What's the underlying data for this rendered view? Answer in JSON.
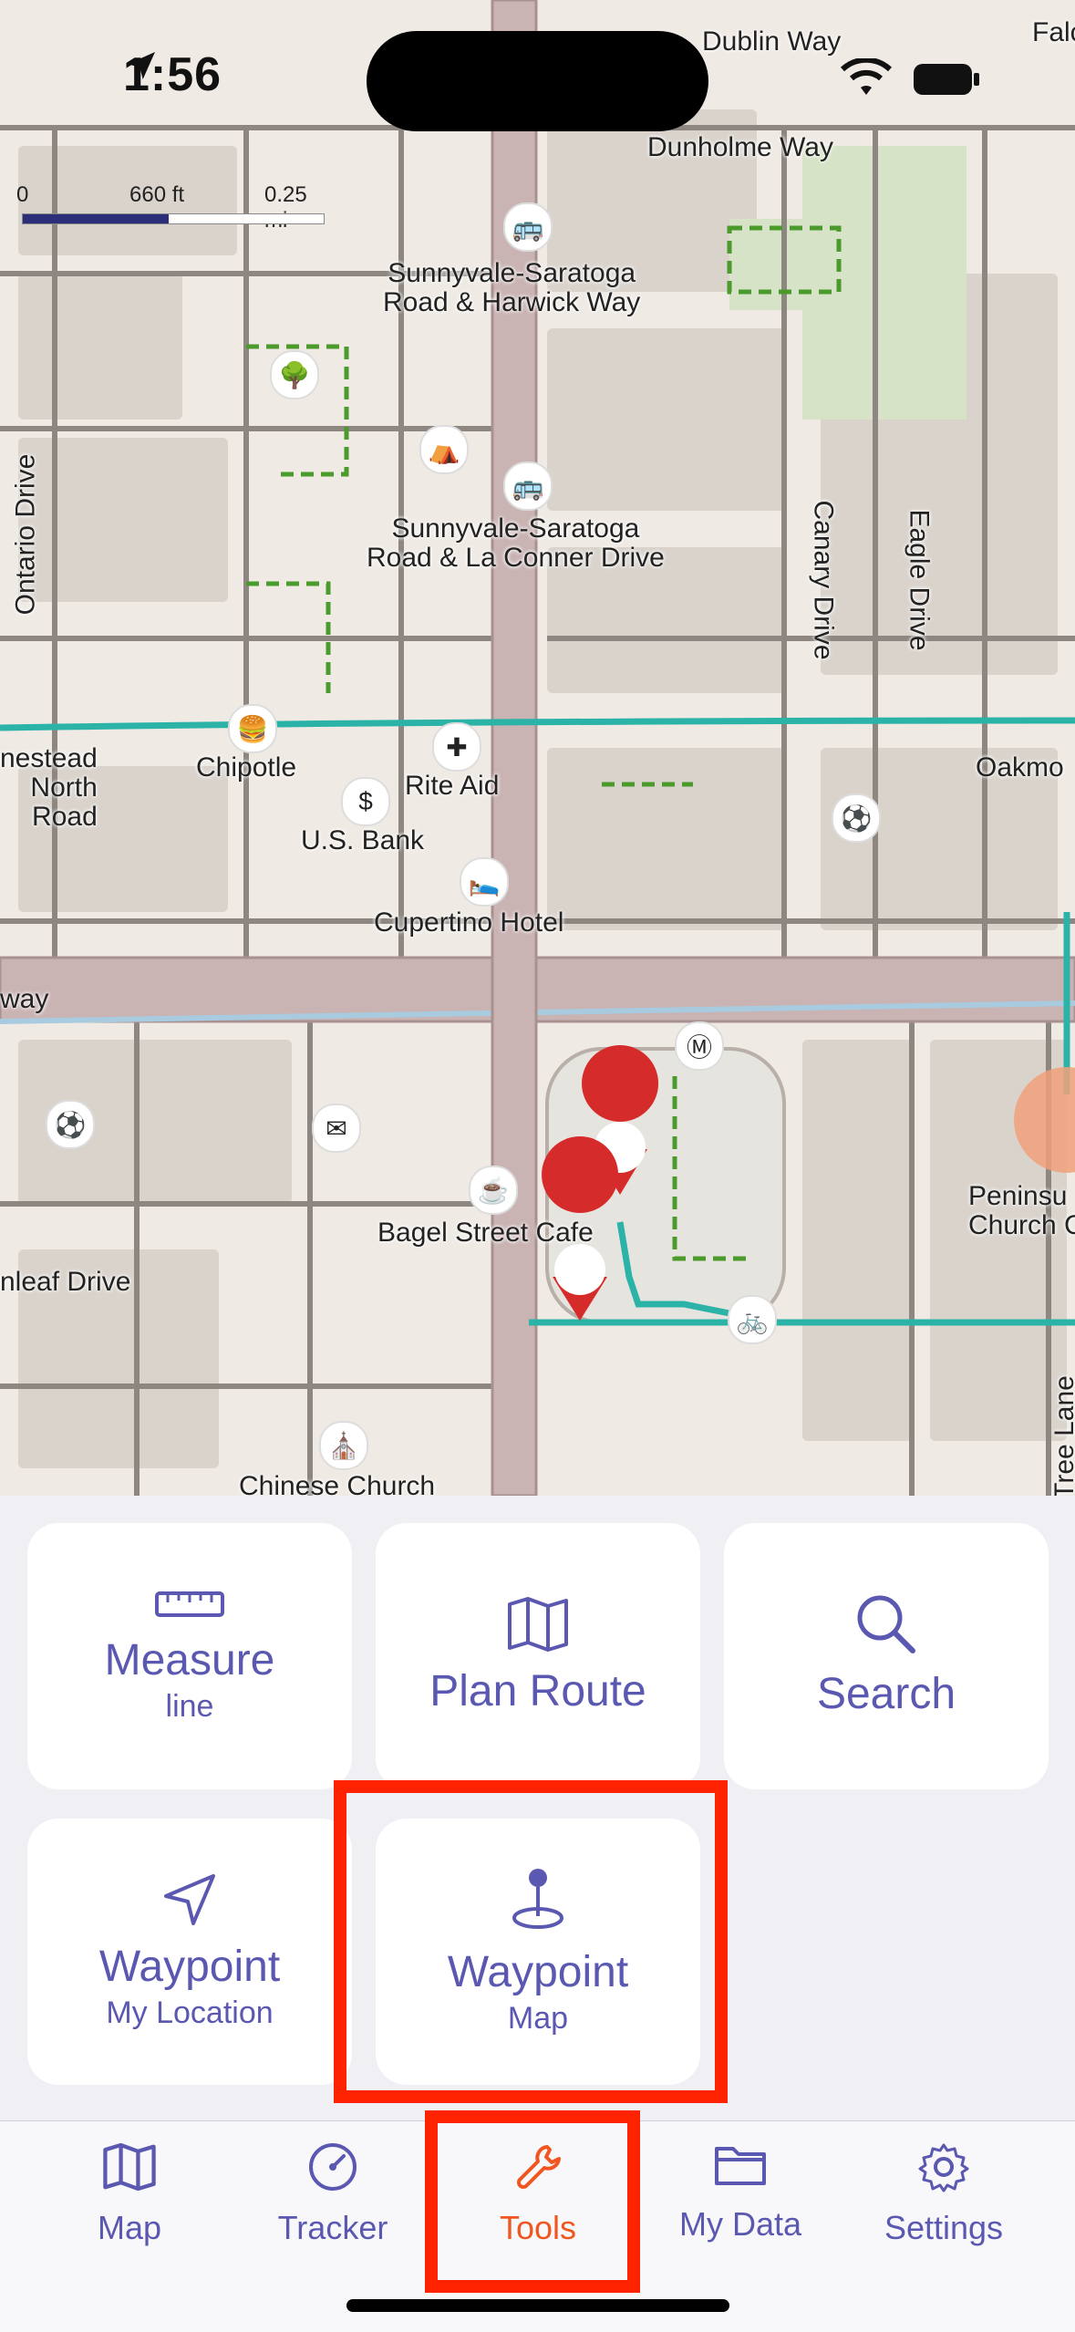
{
  "status_bar": {
    "time": "1:56"
  },
  "map": {
    "scale": {
      "zero": "0",
      "mid": "660 ft",
      "end": "0.25 mi"
    },
    "labels": {
      "dublin_way": "Dublin Way",
      "dunholme_way": "Dunholme Way",
      "falcon": "Falc",
      "stop1_line1": "Sunnyvale-Saratoga",
      "stop1_line2": "Road & Harwick Way",
      "stop2_line1": "Sunnyvale-Saratoga",
      "stop2_line2": "Road & La Conner Drive",
      "ontario_drive": "Ontario Drive",
      "canary_drive": "Canary Drive",
      "eagle_drive": "Eagle Drive",
      "homestead_1": "nestead",
      "homestead_2": "North",
      "homestead_3": "Road",
      "chipotle": "Chipotle",
      "rite_aid": "Rite Aid",
      "us_bank": "U.S. Bank",
      "oakmont": "Oakmo",
      "cupertino_hotel": "Cupertino Hotel",
      "freeway": "way",
      "bagel_cafe": "Bagel Street Cafe",
      "peninsula_1": "Peninsu",
      "peninsula_2": "Church C",
      "leaf_drive": "nleaf Drive",
      "chinese_church": "Chinese Church",
      "tree_lane": "Tree Lane"
    }
  },
  "tools": {
    "measure": {
      "title": "Measure",
      "subtitle": "line",
      "icon": "ruler-icon"
    },
    "plan_route": {
      "title": "Plan Route",
      "icon": "map-icon"
    },
    "search": {
      "title": "Search",
      "icon": "search-icon"
    },
    "waypoint_location": {
      "title": "Waypoint",
      "subtitle": "My Location",
      "icon": "location-arrow-icon"
    },
    "waypoint_map": {
      "title": "Waypoint",
      "subtitle": "Map",
      "icon": "map-pin-icon"
    }
  },
  "tabbar": {
    "items": [
      {
        "label": "Map",
        "icon": "map-icon"
      },
      {
        "label": "Tracker",
        "icon": "speedometer-icon"
      },
      {
        "label": "Tools",
        "icon": "wrench-icon",
        "active": true
      },
      {
        "label": "My Data",
        "icon": "folder-icon"
      },
      {
        "label": "Settings",
        "icon": "gear-icon"
      }
    ]
  },
  "colors": {
    "accent": "#5a58b0",
    "active_tab": "#f0561f",
    "highlight": "#ff2200",
    "trail": "#2bb3a8"
  }
}
